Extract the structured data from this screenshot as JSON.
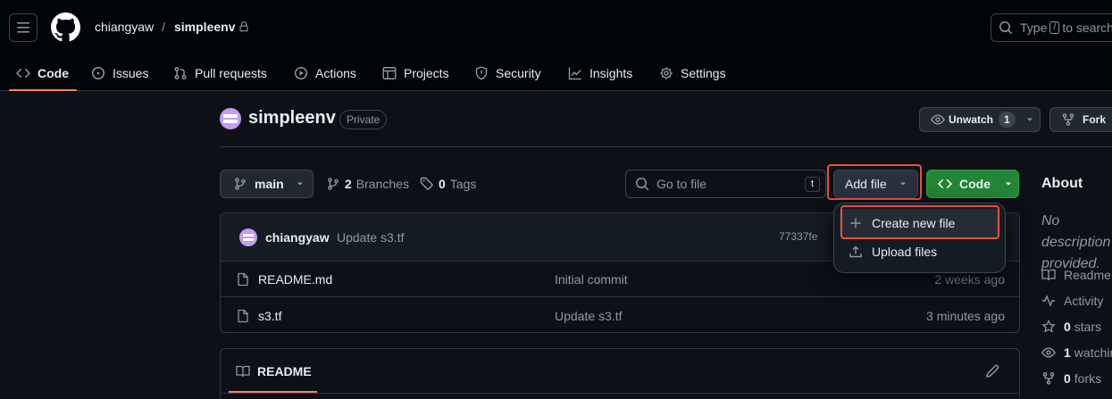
{
  "header": {
    "owner": "chiangyaw",
    "slash": "/",
    "repo": "simpleenv",
    "search_prefix": "Type",
    "search_key": "/",
    "search_suffix": "to search"
  },
  "tabs": [
    {
      "label": "Code",
      "icon": "code-icon"
    },
    {
      "label": "Issues",
      "icon": "issue-icon"
    },
    {
      "label": "Pull requests",
      "icon": "pull-request-icon"
    },
    {
      "label": "Actions",
      "icon": "play-icon"
    },
    {
      "label": "Projects",
      "icon": "table-icon"
    },
    {
      "label": "Security",
      "icon": "shield-icon"
    },
    {
      "label": "Insights",
      "icon": "graph-icon"
    },
    {
      "label": "Settings",
      "icon": "gear-icon"
    }
  ],
  "repo_header": {
    "title": "simpleenv",
    "visibility": "Private",
    "unwatch_label": "Unwatch",
    "watch_count": "1",
    "fork_label": "Fork"
  },
  "toolbar": {
    "branch": "main",
    "branches_count": "2",
    "branches_label": "Branches",
    "tags_count": "0",
    "tags_label": "Tags",
    "goto_placeholder": "Go to file",
    "goto_key": "t",
    "add_file_label": "Add file",
    "code_label": "Code"
  },
  "add_file_menu": {
    "items": [
      {
        "label": "Create new file",
        "icon": "plus-icon"
      },
      {
        "label": "Upload files",
        "icon": "upload-icon"
      }
    ]
  },
  "latest_commit": {
    "author": "chiangyaw",
    "message": "Update s3.tf",
    "sha": "77337fe"
  },
  "files": [
    {
      "name": "README.md",
      "message": "Initial commit",
      "time": "2 weeks ago"
    },
    {
      "name": "s3.tf",
      "message": "Update s3.tf",
      "time": "3 minutes ago"
    }
  ],
  "readme": {
    "tab_label": "README"
  },
  "about": {
    "title": "About",
    "description": "No description provided.",
    "readme_label": "Readme",
    "activity_label": "Activity",
    "stars_count": "0",
    "stars_label": "stars",
    "watching_count": "1",
    "watching_label": "watching",
    "forks_count": "0",
    "forks_label": "forks"
  },
  "colors": {
    "background": "#0d1117",
    "header_bg": "#010409",
    "accent_tab": "#f78166",
    "primary_button": "#238636",
    "highlight": "#e5533d",
    "avatar": "#c69bf0"
  }
}
